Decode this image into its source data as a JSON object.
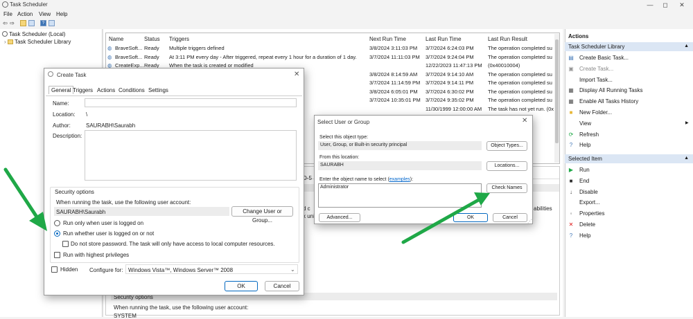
{
  "window": {
    "title": "Task Scheduler",
    "minimize": "—",
    "maximize": "◻",
    "close": "✕"
  },
  "menu": [
    "File",
    "Action",
    "View",
    "Help"
  ],
  "tree": {
    "root": "Task Scheduler (Local)",
    "library": "Task Scheduler Library"
  },
  "tasklist": {
    "headers": [
      "Name",
      "Status",
      "Triggers",
      "Next Run Time",
      "Last Run Time",
      "Last Run Result"
    ],
    "rows": [
      [
        "BraveSoft...",
        "Ready",
        "Multiple triggers defined",
        "3/8/2024 3:11:03 PM",
        "3/7/2024 6:24:03 PM",
        "The operation completed su"
      ],
      [
        "BraveSoft...",
        "Ready",
        "At 3:11 PM every day - After triggered, repeat every 1 hour for a duration of 1 day.",
        "3/7/2024 11:11:03 PM",
        "3/7/2024 9:24:04 PM",
        "The operation completed su"
      ],
      [
        "CreateExp...",
        "Ready",
        "When the task is created or modified",
        "",
        "12/22/2023 11:47:13 PM",
        "(0x40010004)"
      ],
      [
        "",
        "",
        "",
        "3/8/2024 8:14:59 AM",
        "3/7/2024 9:14:10 AM",
        "The operation completed su"
      ],
      [
        "",
        "",
        "ur for a duration of 1 day.",
        "3/7/2024 11:14:59 PM",
        "3/7/2024 9:14:11 PM",
        "The operation completed su"
      ],
      [
        "",
        "",
        "",
        "3/8/2024 6:05:01 PM",
        "3/7/2024 6:30:02 PM",
        "The operation completed su"
      ],
      [
        "",
        "",
        "ur for a duration of 1 day.",
        "3/7/2024 10:35:01 PM",
        "3/7/2024 9:35:02 PM",
        "The operation completed su"
      ],
      [
        "",
        "",
        "",
        "",
        "11/30/1999 12:00:00 AM",
        "The task has not yet run. (0x"
      ],
      [
        "",
        "",
        "",
        "",
        "",
        "t running"
      ],
      [
        "",
        "",
        "",
        "",
        "",
        "running"
      ],
      [
        "",
        "",
        "00:00",
        "",
        "",
        "pleted su"
      ],
      [
        "",
        "",
        "",
        "",
        "",
        "pleted su"
      ]
    ]
  },
  "details": {
    "fragment_id": "D-5",
    "fragment_c": "d c",
    "fragment_uni": "k uni",
    "fragment_abilities": "abilities",
    "security_options": "Security options",
    "run_as_label": "When running the task, use the following user account:",
    "run_as_value": "SYSTEM"
  },
  "actions_panel": {
    "title": "Actions",
    "section1": "Task Scheduler Library",
    "items1": [
      "Create Basic Task...",
      "Create Task...",
      "Import Task...",
      "Display All Running Tasks",
      "Enable All Tasks History",
      "New Folder...",
      "View",
      "Refresh",
      "Help"
    ],
    "section2": "Selected Item",
    "items2": [
      "Run",
      "End",
      "Disable",
      "Export...",
      "Properties",
      "Delete",
      "Help"
    ]
  },
  "create_task": {
    "title": "Create Task",
    "tabs": [
      "General",
      "Triggers",
      "Actions",
      "Conditions",
      "Settings"
    ],
    "name_label": "Name:",
    "name_value": "",
    "location_label": "Location:",
    "location_value": "\\",
    "author_label": "Author:",
    "author_value": "SAURABH\\Saurabh",
    "description_label": "Description:",
    "security_title": "Security options",
    "run_as_label": "When running the task, use the following user account:",
    "run_as_value": "SAURABH\\Saurabh",
    "change_user_button": "Change User or Group...",
    "radio_logged_on": "Run only when user is logged on",
    "radio_whether": "Run whether user is logged on or not",
    "no_store_password": "Do not store password.  The task will only have access to local computer resources.",
    "highest_privileges": "Run with highest privileges",
    "hidden_label": "Hidden",
    "configure_label": "Configure for:",
    "configure_value": "Windows Vista™, Windows Server™ 2008",
    "ok": "OK",
    "cancel": "Cancel"
  },
  "select_user": {
    "title": "Select User or Group",
    "object_type_label": "Select this object type:",
    "object_type_value": "User, Group, or Built-in security principal",
    "object_types_button": "Object Types...",
    "location_label": "From this location:",
    "location_value": "SAURABH",
    "locations_button": "Locations...",
    "enter_label_pre": "Enter the object name to select (",
    "enter_label_link": "examples",
    "enter_label_post": "):",
    "object_name_value": "Administrator",
    "check_names_button": "Check Names",
    "advanced_button": "Advanced...",
    "ok": "OK",
    "cancel": "Cancel"
  },
  "colors": {
    "accent": "#0067c0",
    "arrow": "#1fa847",
    "section_bg": "#dbe6f4"
  }
}
